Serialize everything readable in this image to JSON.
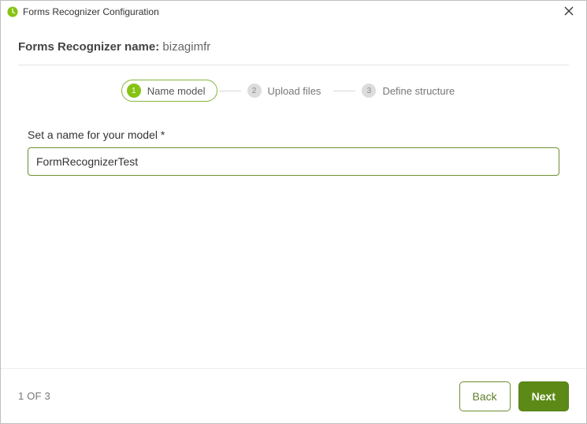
{
  "window": {
    "title": "Forms Recognizer Configuration"
  },
  "header": {
    "label": "Forms Recognizer name:",
    "value": "bizagimfr"
  },
  "stepper": {
    "steps": [
      {
        "num": "1",
        "label": "Name model",
        "active": true
      },
      {
        "num": "2",
        "label": "Upload files",
        "active": false
      },
      {
        "num": "3",
        "label": "Define structure",
        "active": false
      }
    ]
  },
  "form": {
    "model_name_label": "Set a name for your model *",
    "model_name_value": "FormRecognizerTest"
  },
  "footer": {
    "page_indicator": "1 OF 3",
    "back_label": "Back",
    "next_label": "Next"
  },
  "colors": {
    "accent": "#86c313",
    "accent_dark": "#5d8a17",
    "border_input": "#6d8f2f"
  }
}
